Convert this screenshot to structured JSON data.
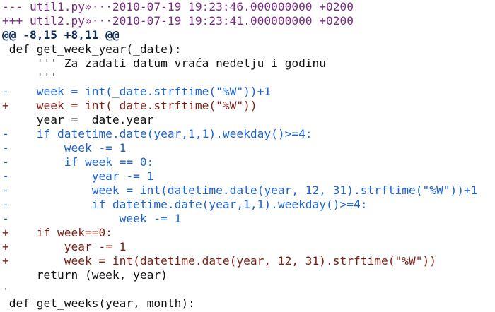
{
  "diff": {
    "header_old": "--- util1.py»···2010-07-19 19:23:46.000000000 +0200",
    "header_new": "+++ util2.py»···2010-07-19 19:23:41.000000000 +0200",
    "hunk": "@@ -8,15 +8,11 @@",
    "lines": [
      {
        "kind": "ctx",
        "text": " def get_week_year(_date):"
      },
      {
        "kind": "ctx",
        "text": "     ''' Za zadati datum vraća nedelju i godinu"
      },
      {
        "kind": "ctx",
        "text": "     '''"
      },
      {
        "kind": "del",
        "text": "-    week = int(_date.strftime(\"%W\"))+1"
      },
      {
        "kind": "add",
        "text": "+    week = int(_date.strftime(\"%W\"))"
      },
      {
        "kind": "ctx",
        "text": "     year = _date.year"
      },
      {
        "kind": "del",
        "text": "-    if datetime.date(year,1,1).weekday()>=4:"
      },
      {
        "kind": "del",
        "text": "-        week -= 1"
      },
      {
        "kind": "del",
        "text": "-        if week == 0:"
      },
      {
        "kind": "del",
        "text": "-            year -= 1"
      },
      {
        "kind": "del",
        "text": "-            week = int(datetime.date(year, 12, 31).strftime(\"%W\"))+1"
      },
      {
        "kind": "del",
        "text": "-            if datetime.date(year,1,1).weekday()>=4:"
      },
      {
        "kind": "del",
        "text": "-                week -= 1"
      },
      {
        "kind": "add",
        "text": "+    if week==0:"
      },
      {
        "kind": "add",
        "text": "+        year -= 1"
      },
      {
        "kind": "add",
        "text": "+        week = int(datetime.date(year, 12, 31).strftime(\"%W\"))"
      },
      {
        "kind": "ctx",
        "text": "     return (week, year)"
      },
      {
        "kind": "ws",
        "text": "·"
      },
      {
        "kind": "ctx",
        "text": " def get_weeks(year, month):"
      }
    ]
  },
  "colors": {
    "header": "#7a2d82",
    "hunk": "#0b2a5a",
    "context": "#111111",
    "removed": "#1c63d6",
    "added": "#7d1f12"
  }
}
